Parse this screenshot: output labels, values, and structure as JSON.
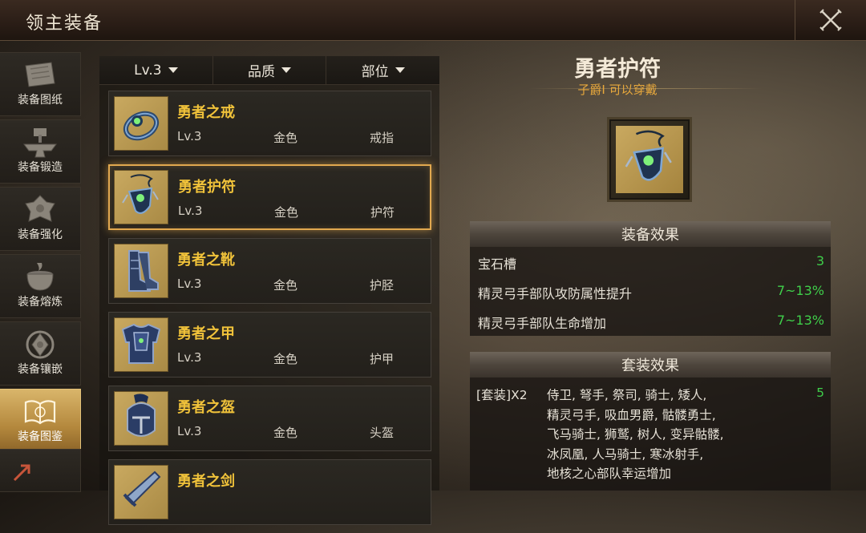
{
  "header": {
    "title": "领主装备",
    "close_icon": "close-x-icon"
  },
  "sidebar": {
    "items": [
      {
        "label": "装备图纸",
        "icon": "blueprint-icon",
        "active": false
      },
      {
        "label": "装备锻造",
        "icon": "anvil-icon",
        "active": false
      },
      {
        "label": "装备强化",
        "icon": "enhance-icon",
        "active": false
      },
      {
        "label": "装备熔炼",
        "icon": "cauldron-icon",
        "active": false
      },
      {
        "label": "装备镶嵌",
        "icon": "gem-socket-icon",
        "active": false
      },
      {
        "label": "装备图鉴",
        "icon": "codex-book-icon",
        "active": true
      }
    ]
  },
  "filters": [
    {
      "label": "Lv.3"
    },
    {
      "label": "品质"
    },
    {
      "label": "部位"
    }
  ],
  "items": [
    {
      "name": "勇者之戒",
      "level": "Lv.3",
      "quality": "金色",
      "slot": "戒指",
      "icon": "ring-icon"
    },
    {
      "name": "勇者护符",
      "level": "Lv.3",
      "quality": "金色",
      "slot": "护符",
      "icon": "amulet-icon",
      "selected": true
    },
    {
      "name": "勇者之靴",
      "level": "Lv.3",
      "quality": "金色",
      "slot": "护胫",
      "icon": "boots-icon"
    },
    {
      "name": "勇者之甲",
      "level": "Lv.3",
      "quality": "金色",
      "slot": "护甲",
      "icon": "armor-icon"
    },
    {
      "name": "勇者之盔",
      "level": "Lv.3",
      "quality": "金色",
      "slot": "头盔",
      "icon": "helmet-icon"
    },
    {
      "name": "勇者之剑",
      "level": "",
      "quality": "",
      "slot": "",
      "icon": "sword-icon"
    }
  ],
  "detail": {
    "name": "勇者护符",
    "requirement": "子爵I 可以穿戴",
    "icon": "amulet-icon",
    "effects_title": "装备效果",
    "effects": [
      {
        "label": "宝石槽",
        "value": "3"
      },
      {
        "label": "精灵弓手部队攻防属性提升",
        "value": "7~13%"
      },
      {
        "label": "精灵弓手部队生命增加",
        "value": "7~13%"
      }
    ],
    "set_title": "套装效果",
    "set": {
      "label": "[套装]X2",
      "lines": [
        "侍卫, 弩手, 祭司, 骑士, 矮人,",
        "精灵弓手, 吸血男爵, 骷髅勇士,",
        "飞马骑士, 狮鹫, 树人, 变异骷髅,",
        "冰凤凰, 人马骑士, 寒冰射手,",
        "地核之心部队幸运增加"
      ],
      "value": "5"
    }
  },
  "colors": {
    "accent_gold": "#f0c23a",
    "value_green": "#3fcf4a",
    "req_orange": "#e8a83c",
    "selected_border": "#e1a84f"
  }
}
